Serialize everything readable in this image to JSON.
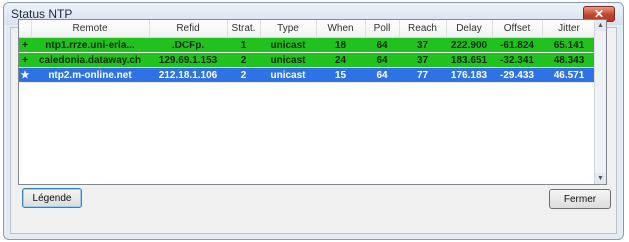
{
  "window": {
    "title": "Status NTP",
    "close_glyph": "✕",
    "close_icon": "close-icon"
  },
  "table": {
    "columns": [
      "Remote",
      "Refid",
      "Strat.",
      "Type",
      "When",
      "Poll",
      "Reach",
      "Delay",
      "Offset",
      "Jitter"
    ],
    "rows": [
      {
        "marker": "+",
        "remote": "ntp1.rrze.uni-erla...",
        "refid": ".DCFp.",
        "strat": "1",
        "type": "unicast",
        "when": "18",
        "poll": "64",
        "reach": "37",
        "delay": "222.900",
        "offset": "-61.824",
        "jitter": "65.141",
        "state": "active"
      },
      {
        "marker": "+",
        "remote": "caledonia.dataway.ch",
        "refid": "129.69.1.153",
        "strat": "2",
        "type": "unicast",
        "when": "24",
        "poll": "64",
        "reach": "37",
        "delay": "183.651",
        "offset": "-32.341",
        "jitter": "48.343",
        "state": "active"
      },
      {
        "marker": "★",
        "remote": "ntp2.m-online.net",
        "refid": "212.18.1.106",
        "strat": "2",
        "type": "unicast",
        "when": "15",
        "poll": "64",
        "reach": "77",
        "delay": "176.183",
        "offset": "-29.433",
        "jitter": "46.571",
        "state": "selected"
      }
    ]
  },
  "scrollbar": {
    "up_glyph": "▲",
    "down_glyph": "▼"
  },
  "buttons": {
    "legend": "Légende",
    "close": "Fermer"
  },
  "colors": {
    "active_row": "#22c21e",
    "selected_row": "#2f72e6"
  }
}
